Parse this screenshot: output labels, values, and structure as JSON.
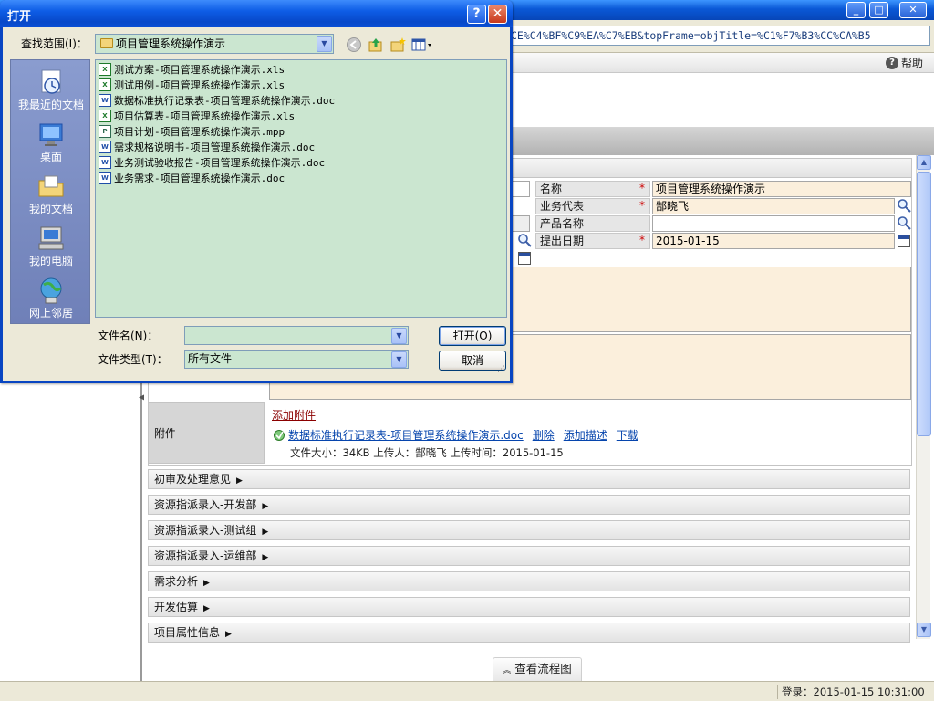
{
  "browser": {
    "address": "CE%C4%BF%C9%EA%C7%EB&topFrame=objTitle=%C1%F7%B3%CC%CA%B5",
    "help_label": "帮助",
    "flow_button": "查看流程图",
    "status_login": "登录：2015-01-15 10:31:00"
  },
  "form": {
    "fields": {
      "name_label": "名称",
      "name_value": "项目管理系统操作演示",
      "biz_rep_label": "业务代表",
      "biz_rep_value": "郜晓飞",
      "product_label": "产品名称",
      "product_value": "",
      "date_label": "提出日期",
      "date_value": "2015-01-15",
      "required_mark": "*"
    },
    "attachment": {
      "label": "附件",
      "add_link": "添加附件",
      "file_name": "数据标准执行记录表-项目管理系统操作演示.doc",
      "delete": "删除",
      "add_desc": "添加描述",
      "download": "下载",
      "meta": "文件大小：34KB  上传人：郜晓飞  上传时间：2015-01-15"
    },
    "sections": [
      {
        "label": "初审及处理意见"
      },
      {
        "label": "资源指派录入-开发部"
      },
      {
        "label": "资源指派录入-测试组"
      },
      {
        "label": "资源指派录入-运维部"
      },
      {
        "label": "需求分析"
      },
      {
        "label": "开发估算"
      },
      {
        "label": "项目属性信息"
      }
    ]
  },
  "dialog": {
    "title": "打开",
    "help_btn": "?",
    "close_btn": "✕",
    "look_in_label": "查找范围(I)：",
    "look_in_value": "项目管理系统操作演示",
    "places": [
      {
        "label": "我最近的文档",
        "icon": "recent-documents-icon"
      },
      {
        "label": "桌面",
        "icon": "desktop-icon"
      },
      {
        "label": "我的文档",
        "icon": "my-documents-icon"
      },
      {
        "label": "我的电脑",
        "icon": "my-computer-icon"
      },
      {
        "label": "网上邻居",
        "icon": "network-places-icon"
      }
    ],
    "files": [
      {
        "name": "测试方案-项目管理系统操作演示.xls",
        "type": "xls"
      },
      {
        "name": "测试用例-项目管理系统操作演示.xls",
        "type": "xls"
      },
      {
        "name": "数据标准执行记录表-项目管理系统操作演示.doc",
        "type": "doc"
      },
      {
        "name": "项目估算表-项目管理系统操作演示.xls",
        "type": "xls"
      },
      {
        "name": "项目计划-项目管理系统操作演示.mpp",
        "type": "mpp"
      },
      {
        "name": "需求规格说明书-项目管理系统操作演示.doc",
        "type": "doc"
      },
      {
        "name": "业务测试验收报告-项目管理系统操作演示.doc",
        "type": "doc"
      },
      {
        "name": "业务需求-项目管理系统操作演示.doc",
        "type": "doc"
      }
    ],
    "filename_label": "文件名(N)：",
    "filename_value": "",
    "filetype_label": "文件类型(T)：",
    "filetype_value": "所有文件",
    "open_btn": "打开(O)",
    "cancel_btn": "取消"
  }
}
